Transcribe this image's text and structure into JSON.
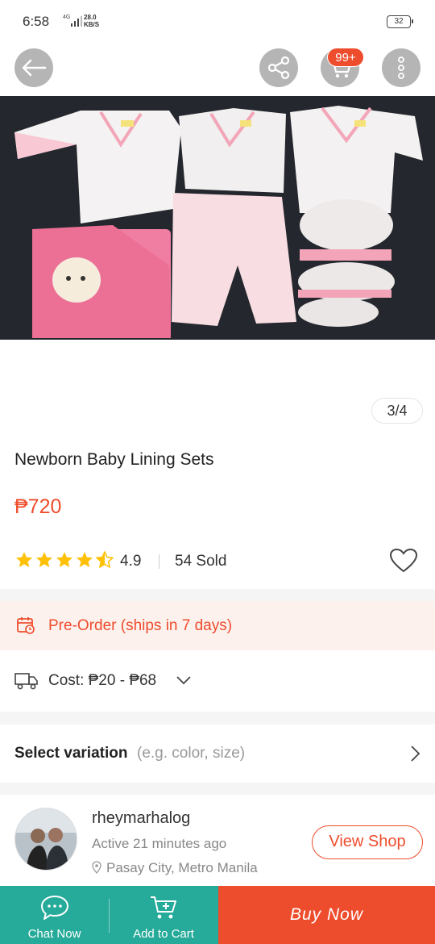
{
  "status_bar": {
    "time": "6:58",
    "network": "4G",
    "speed_value": "28.0",
    "speed_unit": "KB/S",
    "battery": "32"
  },
  "top_bar": {
    "back_icon": "arrow-left-icon",
    "share_icon": "share-icon",
    "cart_icon": "cart-icon",
    "cart_badge": "99+",
    "more_icon": "more-vertical-icon"
  },
  "gallery": {
    "counter": "3/4"
  },
  "product": {
    "title": "Newborn Baby Lining Sets",
    "price": "₱720",
    "rating": "4.9",
    "rating_stars": 4.5,
    "sold": "54 Sold"
  },
  "preorder": {
    "text": "Pre-Order (ships in 7 days)"
  },
  "shipping": {
    "cost": "Cost: ₱20 - ₱68"
  },
  "variation": {
    "label": "Select variation",
    "hint": "(e.g. color, size)"
  },
  "shop": {
    "name": "rheymarhalog",
    "active": "Active 21 minutes ago",
    "location": "Pasay City, Metro Manila",
    "view_shop": "View Shop"
  },
  "bottom_bar": {
    "chat": "Chat Now",
    "add_to_cart": "Add to Cart",
    "buy_now": "Buy Now"
  },
  "colors": {
    "accent": "#ee4d2d",
    "teal": "#26aa99",
    "star": "#ffc107"
  }
}
